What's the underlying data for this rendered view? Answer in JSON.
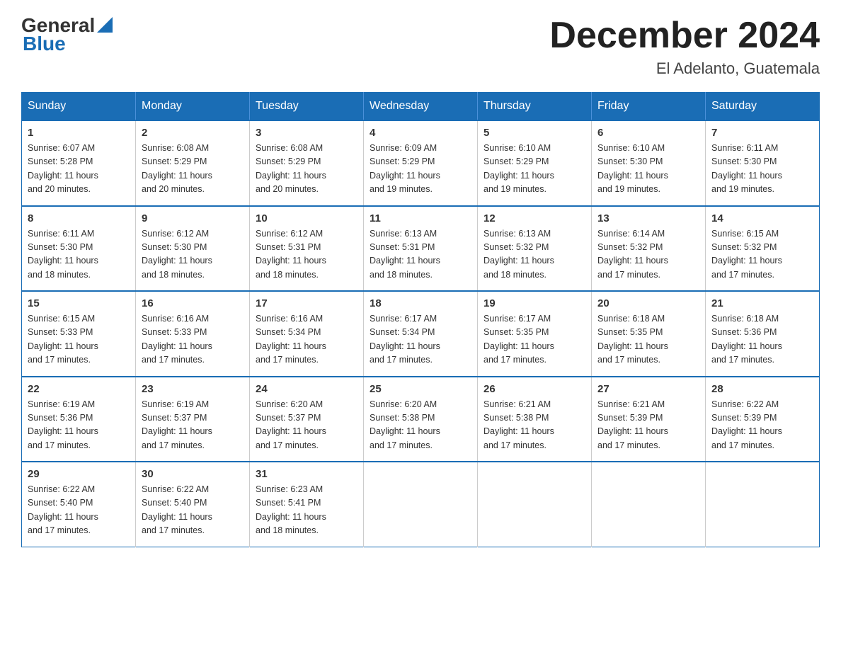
{
  "header": {
    "logo_general": "General",
    "logo_blue": "Blue",
    "month_title": "December 2024",
    "location": "El Adelanto, Guatemala"
  },
  "days_of_week": [
    "Sunday",
    "Monday",
    "Tuesday",
    "Wednesday",
    "Thursday",
    "Friday",
    "Saturday"
  ],
  "weeks": [
    [
      {
        "day": "1",
        "sunrise": "6:07 AM",
        "sunset": "5:28 PM",
        "daylight": "11 hours and 20 minutes."
      },
      {
        "day": "2",
        "sunrise": "6:08 AM",
        "sunset": "5:29 PM",
        "daylight": "11 hours and 20 minutes."
      },
      {
        "day": "3",
        "sunrise": "6:08 AM",
        "sunset": "5:29 PM",
        "daylight": "11 hours and 20 minutes."
      },
      {
        "day": "4",
        "sunrise": "6:09 AM",
        "sunset": "5:29 PM",
        "daylight": "11 hours and 19 minutes."
      },
      {
        "day": "5",
        "sunrise": "6:10 AM",
        "sunset": "5:29 PM",
        "daylight": "11 hours and 19 minutes."
      },
      {
        "day": "6",
        "sunrise": "6:10 AM",
        "sunset": "5:30 PM",
        "daylight": "11 hours and 19 minutes."
      },
      {
        "day": "7",
        "sunrise": "6:11 AM",
        "sunset": "5:30 PM",
        "daylight": "11 hours and 19 minutes."
      }
    ],
    [
      {
        "day": "8",
        "sunrise": "6:11 AM",
        "sunset": "5:30 PM",
        "daylight": "11 hours and 18 minutes."
      },
      {
        "day": "9",
        "sunrise": "6:12 AM",
        "sunset": "5:30 PM",
        "daylight": "11 hours and 18 minutes."
      },
      {
        "day": "10",
        "sunrise": "6:12 AM",
        "sunset": "5:31 PM",
        "daylight": "11 hours and 18 minutes."
      },
      {
        "day": "11",
        "sunrise": "6:13 AM",
        "sunset": "5:31 PM",
        "daylight": "11 hours and 18 minutes."
      },
      {
        "day": "12",
        "sunrise": "6:13 AM",
        "sunset": "5:32 PM",
        "daylight": "11 hours and 18 minutes."
      },
      {
        "day": "13",
        "sunrise": "6:14 AM",
        "sunset": "5:32 PM",
        "daylight": "11 hours and 17 minutes."
      },
      {
        "day": "14",
        "sunrise": "6:15 AM",
        "sunset": "5:32 PM",
        "daylight": "11 hours and 17 minutes."
      }
    ],
    [
      {
        "day": "15",
        "sunrise": "6:15 AM",
        "sunset": "5:33 PM",
        "daylight": "11 hours and 17 minutes."
      },
      {
        "day": "16",
        "sunrise": "6:16 AM",
        "sunset": "5:33 PM",
        "daylight": "11 hours and 17 minutes."
      },
      {
        "day": "17",
        "sunrise": "6:16 AM",
        "sunset": "5:34 PM",
        "daylight": "11 hours and 17 minutes."
      },
      {
        "day": "18",
        "sunrise": "6:17 AM",
        "sunset": "5:34 PM",
        "daylight": "11 hours and 17 minutes."
      },
      {
        "day": "19",
        "sunrise": "6:17 AM",
        "sunset": "5:35 PM",
        "daylight": "11 hours and 17 minutes."
      },
      {
        "day": "20",
        "sunrise": "6:18 AM",
        "sunset": "5:35 PM",
        "daylight": "11 hours and 17 minutes."
      },
      {
        "day": "21",
        "sunrise": "6:18 AM",
        "sunset": "5:36 PM",
        "daylight": "11 hours and 17 minutes."
      }
    ],
    [
      {
        "day": "22",
        "sunrise": "6:19 AM",
        "sunset": "5:36 PM",
        "daylight": "11 hours and 17 minutes."
      },
      {
        "day": "23",
        "sunrise": "6:19 AM",
        "sunset": "5:37 PM",
        "daylight": "11 hours and 17 minutes."
      },
      {
        "day": "24",
        "sunrise": "6:20 AM",
        "sunset": "5:37 PM",
        "daylight": "11 hours and 17 minutes."
      },
      {
        "day": "25",
        "sunrise": "6:20 AM",
        "sunset": "5:38 PM",
        "daylight": "11 hours and 17 minutes."
      },
      {
        "day": "26",
        "sunrise": "6:21 AM",
        "sunset": "5:38 PM",
        "daylight": "11 hours and 17 minutes."
      },
      {
        "day": "27",
        "sunrise": "6:21 AM",
        "sunset": "5:39 PM",
        "daylight": "11 hours and 17 minutes."
      },
      {
        "day": "28",
        "sunrise": "6:22 AM",
        "sunset": "5:39 PM",
        "daylight": "11 hours and 17 minutes."
      }
    ],
    [
      {
        "day": "29",
        "sunrise": "6:22 AM",
        "sunset": "5:40 PM",
        "daylight": "11 hours and 17 minutes."
      },
      {
        "day": "30",
        "sunrise": "6:22 AM",
        "sunset": "5:40 PM",
        "daylight": "11 hours and 17 minutes."
      },
      {
        "day": "31",
        "sunrise": "6:23 AM",
        "sunset": "5:41 PM",
        "daylight": "11 hours and 18 minutes."
      },
      null,
      null,
      null,
      null
    ]
  ],
  "labels": {
    "sunrise": "Sunrise:",
    "sunset": "Sunset:",
    "daylight": "Daylight:"
  }
}
